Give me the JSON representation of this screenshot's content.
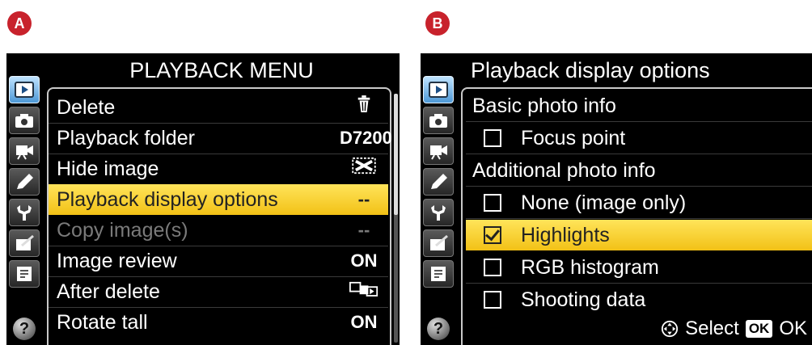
{
  "labels": {
    "a": "A",
    "b": "B"
  },
  "screenA": {
    "title": "PLAYBACK MENU",
    "items": [
      {
        "label": "Delete",
        "value": ""
      },
      {
        "label": "Playback folder",
        "value": "D7200"
      },
      {
        "label": "Hide image",
        "value": ""
      },
      {
        "label": "Playback display options",
        "value": "--"
      },
      {
        "label": "Copy image(s)",
        "value": "--"
      },
      {
        "label": "Image review",
        "value": "ON"
      },
      {
        "label": "After delete",
        "value": ""
      },
      {
        "label": "Rotate tall",
        "value": "ON"
      }
    ],
    "selected_item": "Playback display options",
    "disabled_item": "Copy image(s)"
  },
  "screenB": {
    "title": "Playback display options",
    "section1": "Basic photo info",
    "opt_focus": "Focus point",
    "section2": "Additional photo info",
    "opt_none": "None (image only)",
    "opt_highlights": "Highlights",
    "opt_rgb": "RGB histogram",
    "opt_shooting": "Shooting data",
    "footer_select": "Select",
    "footer_ok_key": "OK",
    "footer_ok": "OK",
    "checked": [
      "Highlights"
    ]
  },
  "colors": {
    "highlight": "#f5cb22",
    "badge": "#c8222c",
    "active_tab": "#6aaee6"
  },
  "icons": [
    "playback-icon",
    "camera-icon",
    "movie-icon",
    "pencil-icon",
    "wrench-icon",
    "retouch-icon",
    "mymenu-icon",
    "help-icon"
  ]
}
